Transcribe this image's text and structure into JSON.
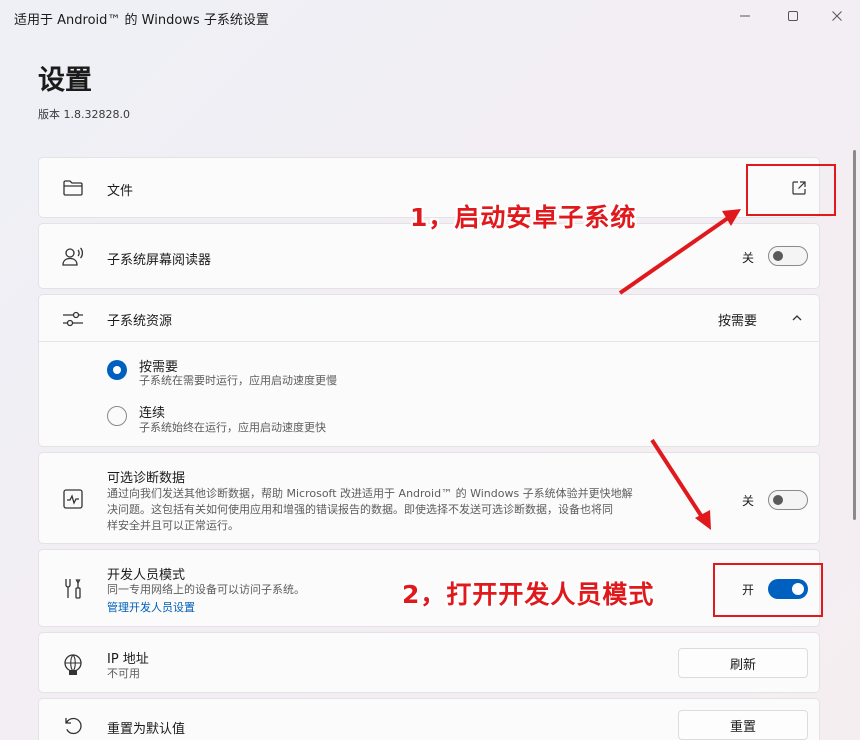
{
  "window": {
    "title": "适用于 Android™ 的 Windows 子系统设置"
  },
  "page": {
    "title": "设置",
    "version": "版本 1.8.32828.0"
  },
  "files": {
    "label": "文件",
    "icon": "folder-icon",
    "action_icon": "open-external-icon"
  },
  "screen_reader": {
    "label": "子系统屏幕阅读器",
    "state_text": "关",
    "enabled": false
  },
  "resources": {
    "label": "子系统资源",
    "selected_value": "按需要",
    "expanded": true,
    "options": [
      {
        "title": "按需要",
        "desc": "子系统在需要时运行，应用启动速度更慢",
        "selected": true
      },
      {
        "title": "连续",
        "desc": "子系统始终在运行，应用启动速度更快",
        "selected": false
      }
    ]
  },
  "diagnostics": {
    "label": "可选诊断数据",
    "desc_line1": "通过向我们发送其他诊断数据，帮助 Microsoft 改进适用于 Android™ 的 Windows 子系统体验并更快地解",
    "desc_line2": "决问题。这包括有关如何使用应用和增强的错误报告的数据。即使选择不发送可选诊断数据，设备也将同",
    "desc_line3": "样安全并且可以正常运行。",
    "state_text": "关",
    "enabled": false
  },
  "developer": {
    "label": "开发人员模式",
    "desc": "同一专用网络上的设备可以访问子系统。",
    "link": "管理开发人员设置",
    "state_text": "开",
    "enabled": true
  },
  "ip": {
    "label": "IP 地址",
    "value": "不可用",
    "button": "刷新"
  },
  "reset": {
    "label": "重置为默认值",
    "button": "重置"
  },
  "annotations": {
    "step1": "1，启动安卓子系统",
    "step2": "2，打开开发人员模式",
    "color": "#e0191d"
  },
  "colors": {
    "accent": "#0060c0",
    "link": "#005fb8"
  }
}
